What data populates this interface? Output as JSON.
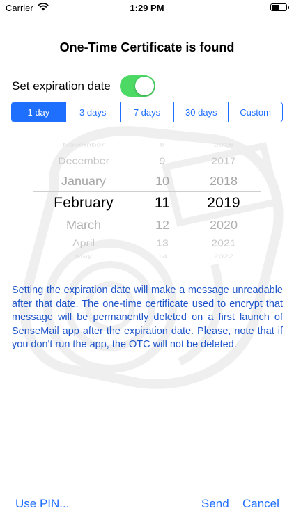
{
  "status": {
    "carrier": "Carrier",
    "time": "1:29 PM",
    "battery_level": 0.55
  },
  "title": "One-Time Certificate is found",
  "expiration": {
    "label": "Set expiration date",
    "enabled": true
  },
  "segments": [
    {
      "label": "1 day",
      "selected": true
    },
    {
      "label": "3 days",
      "selected": false
    },
    {
      "label": "7 days",
      "selected": false
    },
    {
      "label": "30 days",
      "selected": false
    },
    {
      "label": "Custom",
      "selected": false
    }
  ],
  "picker": {
    "rows": [
      {
        "month": "November",
        "day": "8",
        "year": "2016"
      },
      {
        "month": "December",
        "day": "9",
        "year": "2017"
      },
      {
        "month": "January",
        "day": "10",
        "year": "2018"
      },
      {
        "month": "February",
        "day": "11",
        "year": "2019"
      },
      {
        "month": "March",
        "day": "12",
        "year": "2020"
      },
      {
        "month": "April",
        "day": "13",
        "year": "2021"
      },
      {
        "month": "May",
        "day": "14",
        "year": "2022"
      }
    ],
    "selected_index": 3
  },
  "description": "Setting the expiration date will make a message unreadable after that date. The one-time certificate used to encrypt that message will be permanently deleted on a first launch of SenseMail app after the expiration date. Please, note that if you don't run the app, the OTC will not be deleted.",
  "bottom": {
    "use_pin": "Use PIN...",
    "send": "Send",
    "cancel": "Cancel"
  },
  "colors": {
    "accent": "#1f6fff",
    "toggle_on": "#4cd964",
    "description_text": "#1f55c9"
  },
  "icons": {
    "wifi": "wifi-icon",
    "battery": "battery-icon",
    "watermark": "watermark-logo"
  }
}
